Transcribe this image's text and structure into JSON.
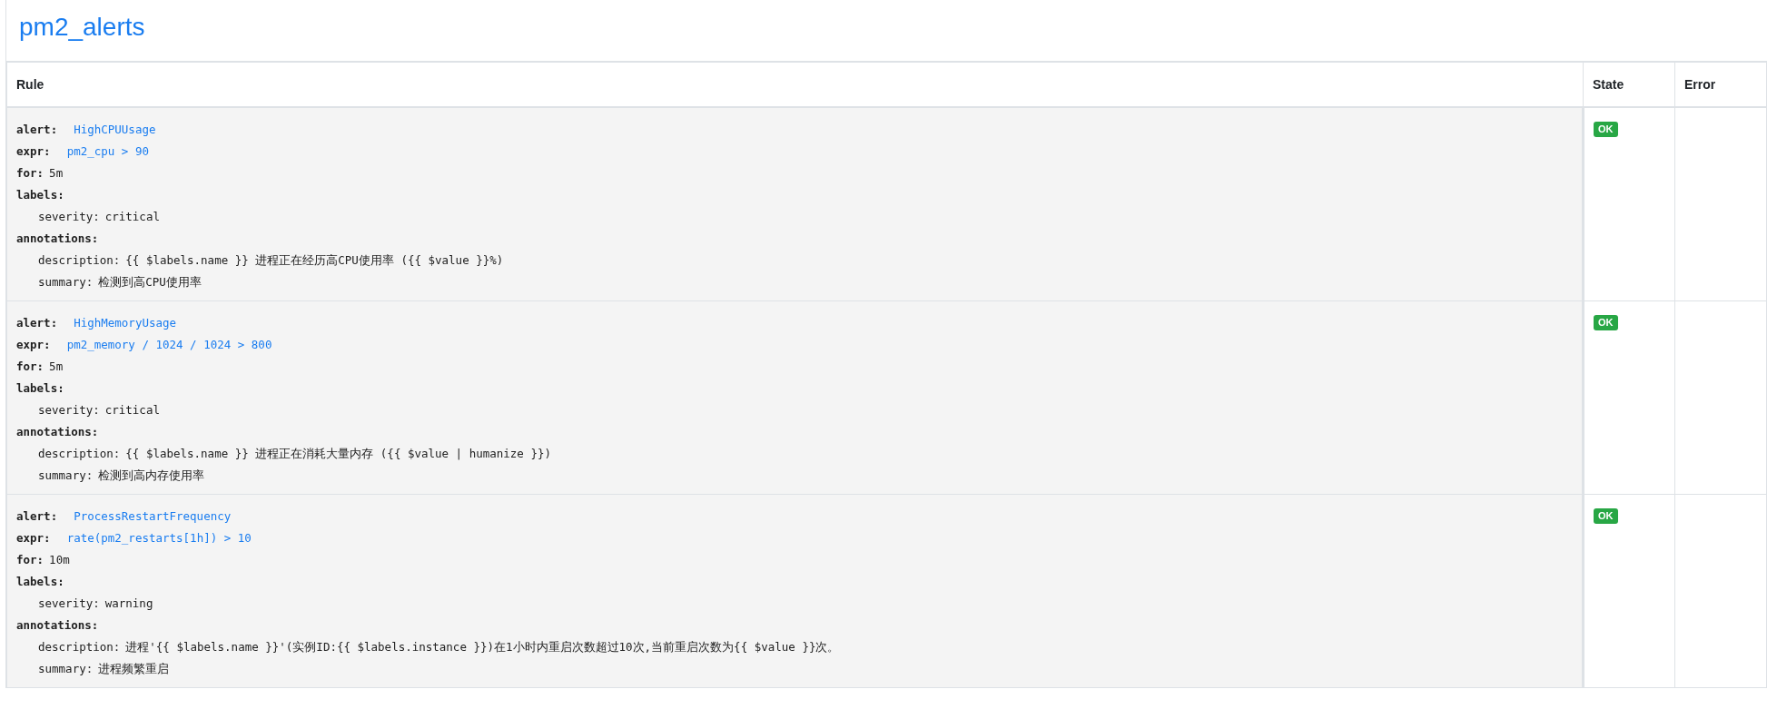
{
  "title": "pm2_alerts",
  "columns": [
    "Rule",
    "State",
    "Error"
  ],
  "rules": [
    {
      "lines": [
        {
          "kind": "link",
          "key": "alert:",
          "value": "HighCPUUsage"
        },
        {
          "kind": "link",
          "key": "expr:",
          "value": "pm2_cpu > 90"
        },
        {
          "kind": "plain",
          "key": "for:",
          "value": "5m"
        },
        {
          "kind": "section",
          "key": "labels:"
        },
        {
          "kind": "entry",
          "key": "severity:",
          "value": "critical"
        },
        {
          "kind": "section",
          "key": "annotations:"
        },
        {
          "kind": "entry",
          "key": "description:",
          "value": "{{ $labels.name }} 进程正在经历高CPU使用率 ({{ $value }}%)"
        },
        {
          "kind": "entry",
          "key": "summary:",
          "value": "检测到高CPU使用率"
        }
      ],
      "state": "OK"
    },
    {
      "lines": [
        {
          "kind": "link",
          "key": "alert:",
          "value": "HighMemoryUsage"
        },
        {
          "kind": "link",
          "key": "expr:",
          "value": "pm2_memory / 1024 / 1024 > 800"
        },
        {
          "kind": "plain",
          "key": "for:",
          "value": "5m"
        },
        {
          "kind": "section",
          "key": "labels:"
        },
        {
          "kind": "entry",
          "key": "severity:",
          "value": "critical"
        },
        {
          "kind": "section",
          "key": "annotations:"
        },
        {
          "kind": "entry",
          "key": "description:",
          "value": "{{ $labels.name }} 进程正在消耗大量内存 ({{ $value | humanize }})"
        },
        {
          "kind": "entry",
          "key": "summary:",
          "value": "检测到高内存使用率"
        }
      ],
      "state": "OK"
    },
    {
      "lines": [
        {
          "kind": "link",
          "key": "alert:",
          "value": "ProcessRestartFrequency"
        },
        {
          "kind": "link",
          "key": "expr:",
          "value": "rate(pm2_restarts[1h]) > 10"
        },
        {
          "kind": "plain",
          "key": "for:",
          "value": "10m"
        },
        {
          "kind": "section",
          "key": "labels:"
        },
        {
          "kind": "entry",
          "key": "severity:",
          "value": "warning"
        },
        {
          "kind": "section",
          "key": "annotations:"
        },
        {
          "kind": "entry",
          "key": "description:",
          "value": "进程'{{ $labels.name }}'(实例ID:{{ $labels.instance }})在1小时内重启次数超过10次,当前重启次数为{{ $value }}次。"
        },
        {
          "kind": "entry",
          "key": "summary:",
          "value": "进程频繁重启"
        }
      ],
      "state": "OK"
    }
  ]
}
